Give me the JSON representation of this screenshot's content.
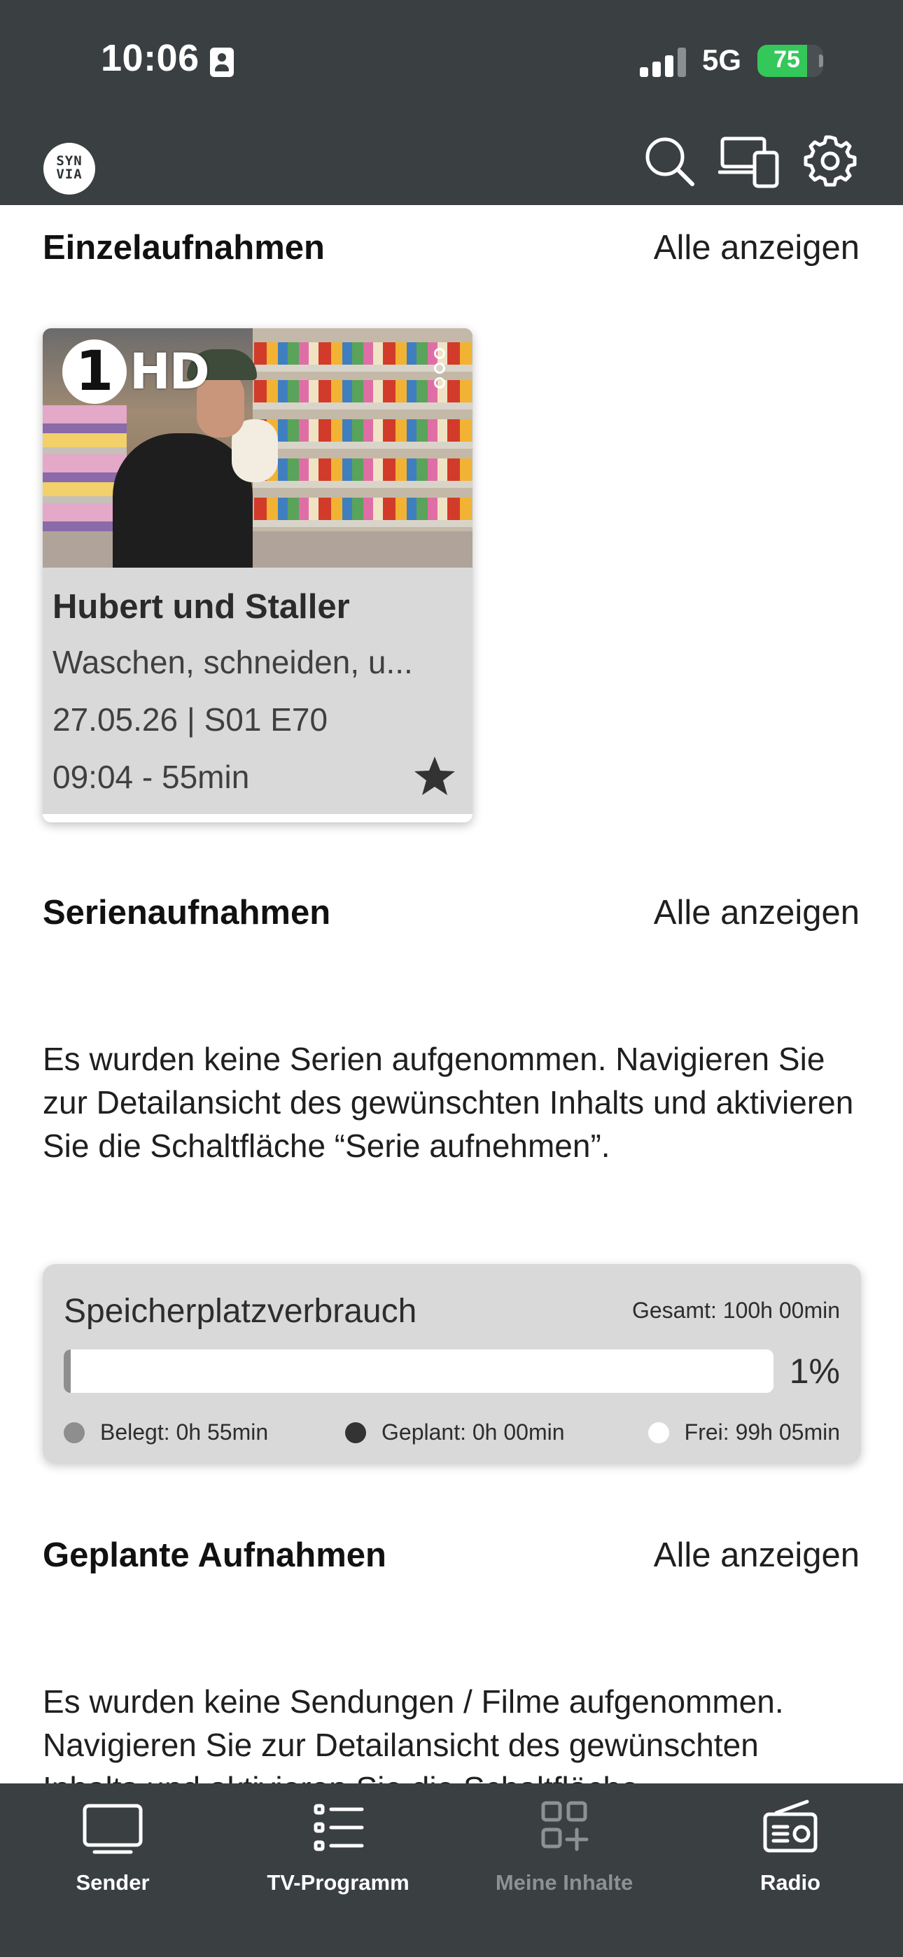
{
  "status_bar": {
    "time": "10:06",
    "network": "5G",
    "battery": "75",
    "battery_level": 0.75
  },
  "header": {
    "logo": "SYN VIA",
    "icons": [
      "search-icon",
      "devices-icon",
      "settings-icon"
    ]
  },
  "single_recordings": {
    "title": "Einzelaufnahmen",
    "show_all": "Alle anzeigen",
    "items": [
      {
        "channel": "HD",
        "title": "Hubert und Staller",
        "subtitle": "Waschen, schneiden, u...",
        "date_episode": "27.05.26 | S01 E70",
        "time_duration": "09:04 - 55min"
      }
    ]
  },
  "series_recordings": {
    "title": "Serienaufnahmen",
    "show_all": "Alle anzeigen",
    "empty_text": "Es wurden keine Serien aufgenommen. Navigieren Sie zur Detailansicht des gewünschten Inhalts und aktivieren Sie die Schaltfläche “Serie aufnehmen”."
  },
  "storage": {
    "title": "Speicherplatzverbrauch",
    "total": "Gesamt: 100h 00min",
    "percent": "1%",
    "used_fraction": 0.01,
    "legend": {
      "used": "Belegt: 0h 55min",
      "planned": "Geplant: 0h 00min",
      "free": "Frei: 99h 05min"
    },
    "colors": {
      "used": "#8e8e8e",
      "planned": "#333333",
      "free": "#ffffff"
    }
  },
  "planned_recordings": {
    "title": "Geplante Aufnahmen",
    "show_all": "Alle anzeigen",
    "empty_text": "Es wurden keine Sendungen / Filme aufgenommen. Navigieren Sie zur Detailansicht des gewünschten Inhalts und aktivieren Sie die Schaltfläche"
  },
  "tabbar": {
    "tabs": [
      {
        "label": "Sender",
        "icon": "tv-icon",
        "active": true
      },
      {
        "label": "TV-Programm",
        "icon": "list-icon",
        "active": true
      },
      {
        "label": "Meine Inhalte",
        "icon": "grid-plus-icon",
        "active": false
      },
      {
        "label": "Radio",
        "icon": "radio-icon",
        "active": true
      }
    ]
  }
}
